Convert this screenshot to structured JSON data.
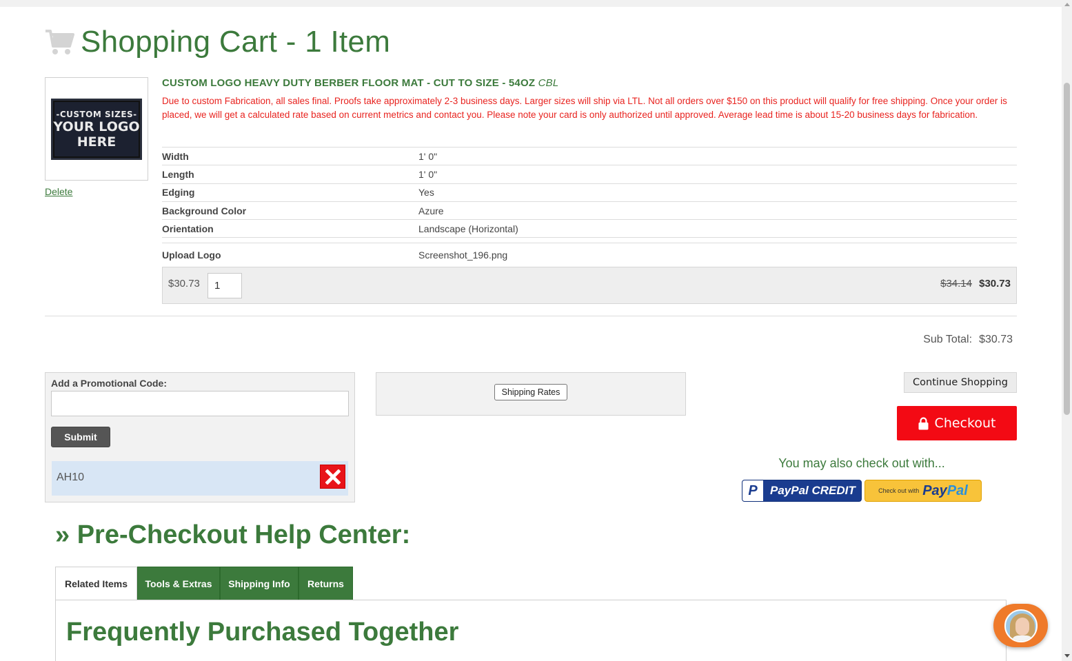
{
  "cart": {
    "title": "Shopping Cart - 1 Item",
    "icon": "shopping-cart-icon"
  },
  "item": {
    "thumbnail_text": [
      "-CUSTOM SIZES-",
      "YOUR LOGO",
      "HERE"
    ],
    "delete_label": "Delete",
    "title": "CUSTOM LOGO HEAVY DUTY BERBER FLOOR MAT - CUT TO SIZE - 54OZ",
    "sku": "CBL",
    "notice": "Due to custom Fabrication, all sales final. Proofs take approximately 2-3 business days. Larger sizes will ship via LTL. Not all orders over $150 on this product will qualify for free shipping. Once your order is placed, we will get a calculated rate based on current metrics and contact you. Please note your card is only authorized until approved. Average lead time is about 15-20 business days for fabrication.",
    "options": [
      {
        "label": "Width",
        "value": "1' 0\""
      },
      {
        "label": "Length",
        "value": "1' 0\""
      },
      {
        "label": "Edging",
        "value": "Yes"
      },
      {
        "label": "Background Color",
        "value": "Azure"
      },
      {
        "label": "Orientation",
        "value": "Landscape (Horizontal)"
      }
    ],
    "upload": {
      "label": "Upload Logo",
      "value": "Screenshot_196.png"
    },
    "unit_price": "$30.73",
    "quantity": "1",
    "original_price": "$34.14",
    "line_total": "$30.73"
  },
  "subtotal": {
    "label": "Sub Total:",
    "value": "$30.73"
  },
  "promo": {
    "label": "Add a Promotional Code:",
    "input_value": "",
    "submit_label": "Submit",
    "applied_code": "AH10",
    "remove_icon": "close-x-icon"
  },
  "shipping": {
    "button_label": "Shipping Rates"
  },
  "actions": {
    "continue_label": "Continue Shopping",
    "checkout_label": "Checkout",
    "checkout_icon": "lock-icon",
    "also_checkout_text": "You may also check out with...",
    "paypal_credit_label": "PayPal CREDIT",
    "paypal_checkout_small": "Check out with",
    "paypal_word_1": "Pay",
    "paypal_word_2": "Pal"
  },
  "help": {
    "title": "» Pre-Checkout Help Center:",
    "tabs": [
      {
        "label": "Related Items",
        "active": true
      },
      {
        "label": "Tools & Extras",
        "active": false
      },
      {
        "label": "Shipping Info",
        "active": false
      },
      {
        "label": "Returns",
        "active": false
      }
    ],
    "panel_title": "Frequently Purchased Together"
  },
  "colors": {
    "brand_green": "#3c7a3c",
    "checkout_red": "#f30a14",
    "notice_red": "#e8231f",
    "paypal_blue": "#1a3c8f",
    "paypal_gold": "#f8c33a",
    "chat_orange": "#ef7a2a"
  },
  "chat": {
    "icon": "chat-agent-avatar-icon"
  }
}
